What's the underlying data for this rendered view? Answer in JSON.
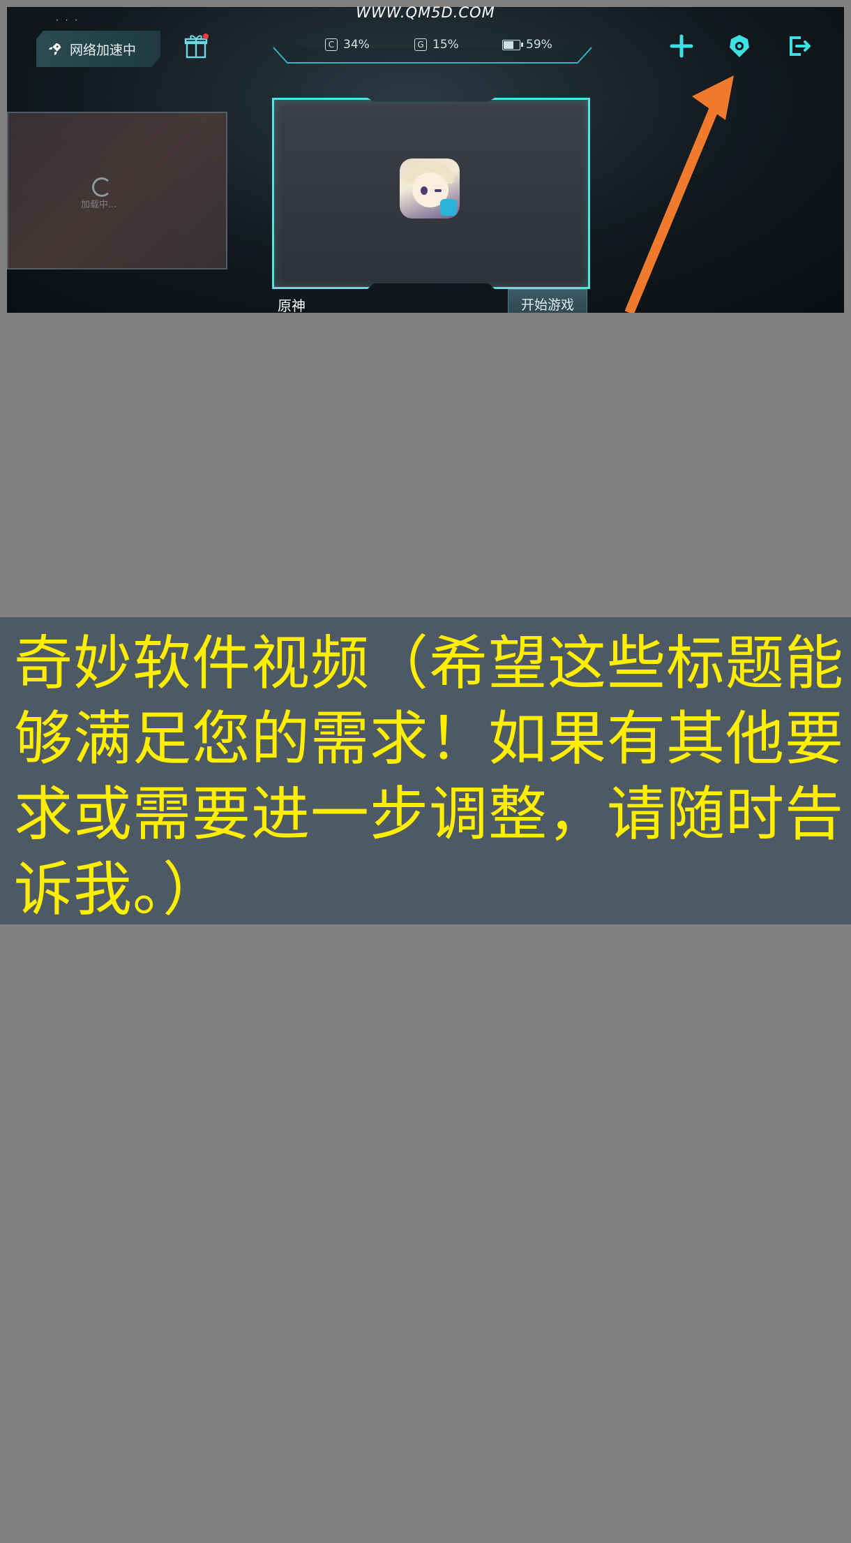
{
  "watermark": "WWW.QM5D.COM",
  "accelerate_button": {
    "label": "网络加速中",
    "icon": "rocket-icon"
  },
  "gift_icon": "gift-icon",
  "stats": {
    "cpu": {
      "badge": "C",
      "value": "34%"
    },
    "gpu": {
      "badge": "G",
      "value": "15%"
    },
    "battery": {
      "value": "59%",
      "level": 0.59
    }
  },
  "toolbar": {
    "add_icon": "plus-icon",
    "settings_icon": "shield-gear-icon",
    "exit_icon": "exit-icon"
  },
  "side_card": {
    "loading_text": "加载中..."
  },
  "game": {
    "name": "原神",
    "start_label": "开始游戏"
  },
  "colors": {
    "accent": "#55e3e0",
    "arrow": "#f07a2e",
    "caption_text": "#ffee00",
    "caption_bg": "#4d5a65",
    "page_bg": "#808080"
  },
  "caption": "奇妙软件视频（希望这些标题能够满足您的需求！如果有其他要求或需要进一步调整，请随时告诉我。）"
}
